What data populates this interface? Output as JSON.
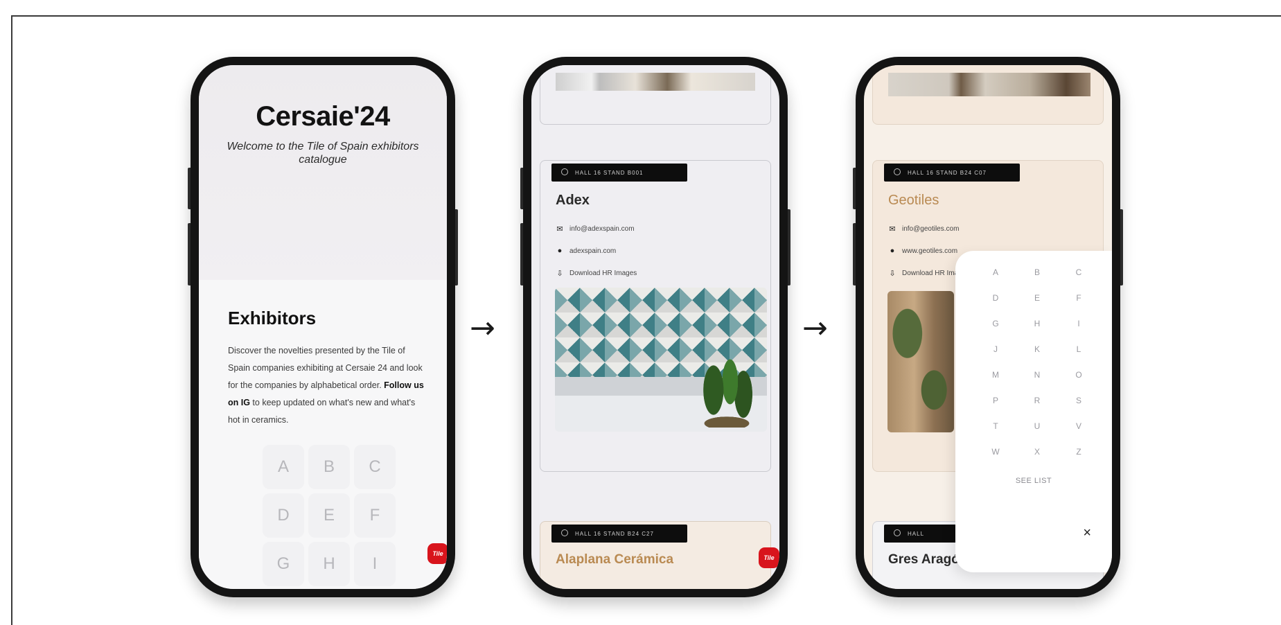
{
  "colors": {
    "fab_red": "#d8141c",
    "pill_black": "#0d0d0d",
    "accent_tan": "#b98a52"
  },
  "phone1": {
    "title": "Cersaie'24",
    "subtitle": "Welcome to the Tile of Spain exhibitors catalogue",
    "section_title": "Exhibitors",
    "body_before_link": "Discover the novelties presented by the Tile of Spain companies exhibiting at Cersaie 24 and look for the companies by alphabetical order. ",
    "body_link": "Follow us on IG",
    "body_after_link": " to keep updated on what's new and what's hot in ceramics.",
    "letters": [
      "A",
      "B",
      "C",
      "D",
      "E",
      "F",
      "G",
      "H",
      "I"
    ],
    "fab_icon": "tile-of-spain-logo-icon",
    "fab_label": "Tile"
  },
  "arrows": [
    "→",
    "→"
  ],
  "phone2": {
    "pill": "HALL 16 STAND B001",
    "company": "Adex",
    "email": "info@adexspain.com",
    "website": "adexspain.com",
    "download": "Download HR Images",
    "bottom_pill": "HALL 16 STAND B24 C27",
    "bottom_company": "Alaplana Cerámica",
    "fab_label": "Tile"
  },
  "phone3": {
    "pill": "HALL 16 STAND B24 C07",
    "company": "Geotiles",
    "email": "info@geotiles.com",
    "website": "www.geotiles.com",
    "download": "Download HR Images",
    "letters": [
      "A",
      "B",
      "C",
      "D",
      "E",
      "F",
      "G",
      "H",
      "I",
      "J",
      "K",
      "L",
      "M",
      "N",
      "O",
      "P",
      "R",
      "S",
      "T",
      "U",
      "V",
      "W",
      "X",
      "Z"
    ],
    "see_all": "SEE LIST",
    "close": "×",
    "bottom_pill": "HALL",
    "bottom_company": "Gres Aragón"
  }
}
